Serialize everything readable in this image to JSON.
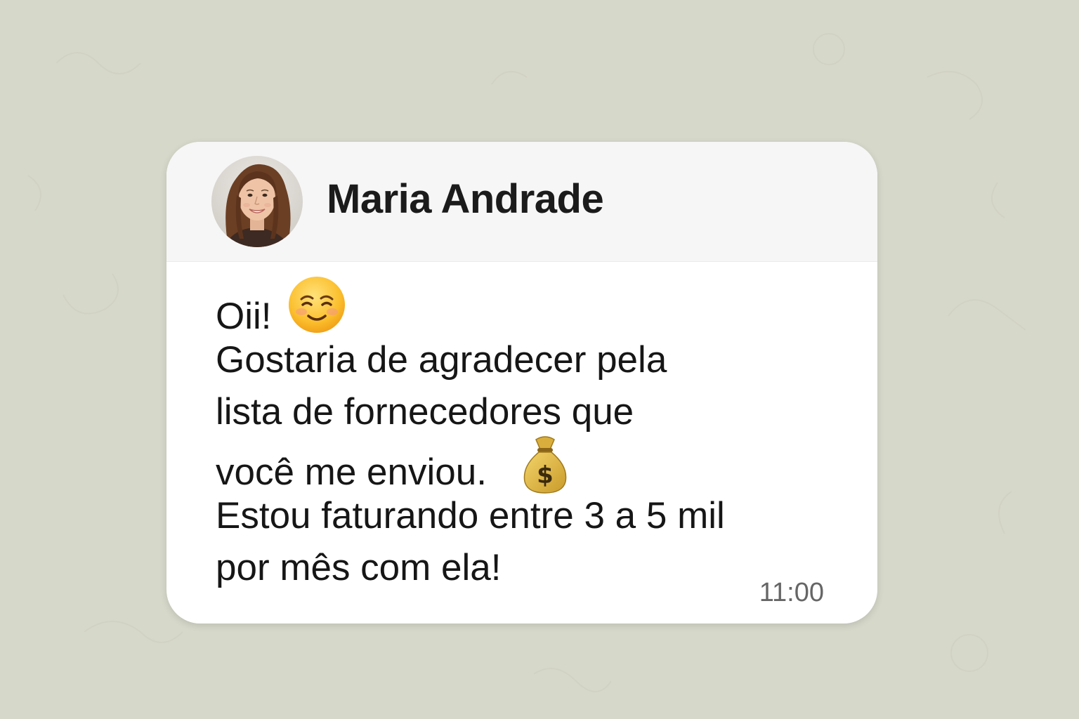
{
  "chat": {
    "contact": {
      "name": "Maria Andrade",
      "avatar_icon": "profile-photo-woman"
    },
    "message": {
      "line1": "Oii!",
      "line1_emoji": "smiling-face-icon",
      "line2": "Gostaria de agradecer pela",
      "line3": "lista de fornecedores que",
      "line4": "você me enviou.",
      "line4_emoji": "money-bag-icon",
      "line5": "Estou faturando entre 3 a 5 mil",
      "line6": "por mês com ela!",
      "time": "11:00"
    }
  },
  "colors": {
    "background": "#d6d8ca",
    "bubble": "#ffffff",
    "header": "#f6f6f6",
    "text": "#161616",
    "timestamp": "#666666"
  }
}
